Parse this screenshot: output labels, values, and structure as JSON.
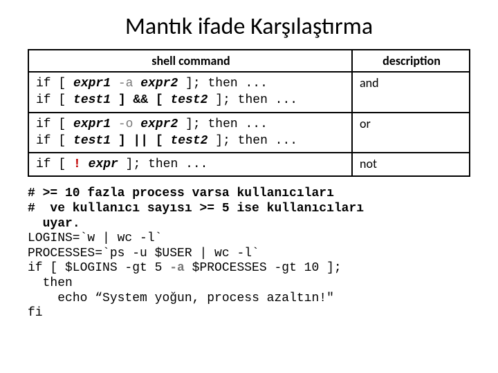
{
  "title": "Mantık ifade Karşılaştırma",
  "table": {
    "head_cmd": "shell command",
    "head_desc": "description",
    "r1a_p1": "if [ ",
    "r1a_expr1": "expr1",
    "r1a_op": " -a ",
    "r1a_expr2": "expr2",
    "r1a_p2": " ]; then ...",
    "r1b_p1": "if [ ",
    "r1b_t1": "test1",
    "r1b_mid": " ] && [ ",
    "r1b_t2": "test2",
    "r1b_p2": " ]; then ...",
    "r1_desc": "and",
    "r2a_p1": "if [ ",
    "r2a_expr1": "expr1",
    "r2a_op": " -o ",
    "r2a_expr2": "expr2",
    "r2a_p2": " ]; then ...",
    "r2b_p1": "if [ ",
    "r2b_t1": "test1",
    "r2b_mid": " ] || [ ",
    "r2b_t2": "test2",
    "r2b_p2": " ]; then ...",
    "r2_desc": "or",
    "r3_p1": "if [ ",
    "r3_bang": "!",
    "r3_sp": " ",
    "r3_expr": "expr",
    "r3_p2": " ]; then ...",
    "r3_desc": "not"
  },
  "code": {
    "c1": "# >= 10 fazla process varsa kullanıcıları",
    "c2": "#  ve kullanıcı sayısı >= 5 ise kullanıcıları",
    "c3": "  uyar.",
    "c4": "LOGINS=`w | wc -l`",
    "c5": "PROCESSES=`ps -u $USER | wc -l`",
    "c6a": "if [ $LOGINS -gt 5 ",
    "c6op": "-a",
    "c6b": " $PROCESSES -gt 10 ];",
    "c7": "  then",
    "c8": "    echo “System yoğun, process azaltın!\"",
    "c9": "fi"
  }
}
